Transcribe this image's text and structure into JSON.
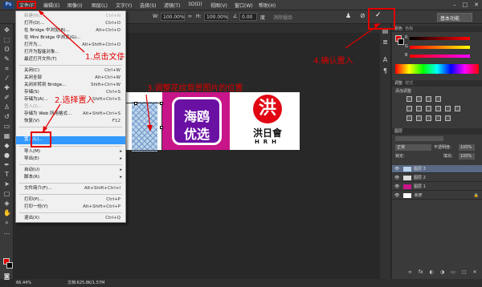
{
  "menubar": {
    "items": [
      "文件(F)",
      "编辑(E)",
      "图像(I)",
      "图层(L)",
      "文字(Y)",
      "选择(S)",
      "滤镜(T)",
      "3D(D)",
      "视图(V)",
      "窗口(W)",
      "帮助(H)"
    ]
  },
  "window_controls": {
    "minimize": "–",
    "maximize": "□",
    "close": "✕"
  },
  "options": {
    "w_value": "100.00%",
    "h_value": "100.00%",
    "angle_value": "0.00",
    "anti_alias_label": "消除锯齿",
    "workspace": "基本功能"
  },
  "file_menu": {
    "items": [
      {
        "label": "新建(N)...",
        "shortcut": "Ctrl+N"
      },
      {
        "label": "打开(O)...",
        "shortcut": "Ctrl+O"
      },
      {
        "label": "在 Bridge 中浏览(B)...",
        "shortcut": "Alt+Ctrl+O"
      },
      {
        "label": "在 Mini Bridge 中浏览(G)...",
        "shortcut": ""
      },
      {
        "label": "打开为...",
        "shortcut": "Alt+Shift+Ctrl+O"
      },
      {
        "label": "打开为智能对象...",
        "shortcut": ""
      },
      {
        "label": "最近打开文件(T)",
        "shortcut": ""
      },
      {
        "label": "关闭(C)",
        "shortcut": "Ctrl+W"
      },
      {
        "label": "关闭全部",
        "shortcut": "Alt+Ctrl+W"
      },
      {
        "label": "关闭并转到 Bridge...",
        "shortcut": "Shift+Ctrl+W"
      },
      {
        "label": "存储(S)",
        "shortcut": "Ctrl+S"
      },
      {
        "label": "存储为(A)...",
        "shortcut": "Shift+Ctrl+S"
      },
      {
        "label": "签入(I)...",
        "shortcut": ""
      },
      {
        "label": "存储为 Web 所用格式...",
        "shortcut": "Alt+Shift+Ctrl+S"
      },
      {
        "label": "恢复(V)",
        "shortcut": "F12"
      },
      {
        "label": "置入(L)...",
        "shortcut": ""
      },
      {
        "label": "导入(M)",
        "shortcut": ""
      },
      {
        "label": "导出(E)",
        "shortcut": ""
      },
      {
        "label": "自动(U)",
        "shortcut": ""
      },
      {
        "label": "脚本(R)",
        "shortcut": ""
      },
      {
        "label": "文件简介(F)...",
        "shortcut": "Alt+Shift+Ctrl+I"
      },
      {
        "label": "打印(P)...",
        "shortcut": "Ctrl+P"
      },
      {
        "label": "打印一份(Y)",
        "shortcut": "Alt+Shift+Ctrl+P"
      },
      {
        "label": "退出(X)",
        "shortcut": "Ctrl+Q"
      }
    ]
  },
  "annotations": {
    "step1": "1.点击文件",
    "step2": "2.选择置入",
    "step3": "3.调整花纹背景图片的位置",
    "step4": "4.确认置入"
  },
  "logos": {
    "logo1_line1": "海鸥",
    "logo1_line2": "优选",
    "logo2_symbol": "洪",
    "logo2_name": "洪日會",
    "logo2_letters": "HRH"
  },
  "right_panel": {
    "color_tab": "颜色",
    "swatches_tab": "色板",
    "adjust_tab": "调整",
    "styles_tab": "样式",
    "adjust_subtitle": "添加调整",
    "layers_tab": "图层",
    "blend_mode": "正常",
    "opacity_label": "不透明度:",
    "opacity_value": "100%",
    "lock_label": "锁定:",
    "fill_label": "填充:",
    "fill_value": "100%",
    "layers": [
      "图层 3",
      "图层 2",
      "图层 1",
      "背景"
    ],
    "r_label": "R",
    "g_label": "G",
    "b_label": "B"
  },
  "status": {
    "zoom": "66.44%",
    "doc_info": "文档:625.8K/1.57M"
  }
}
